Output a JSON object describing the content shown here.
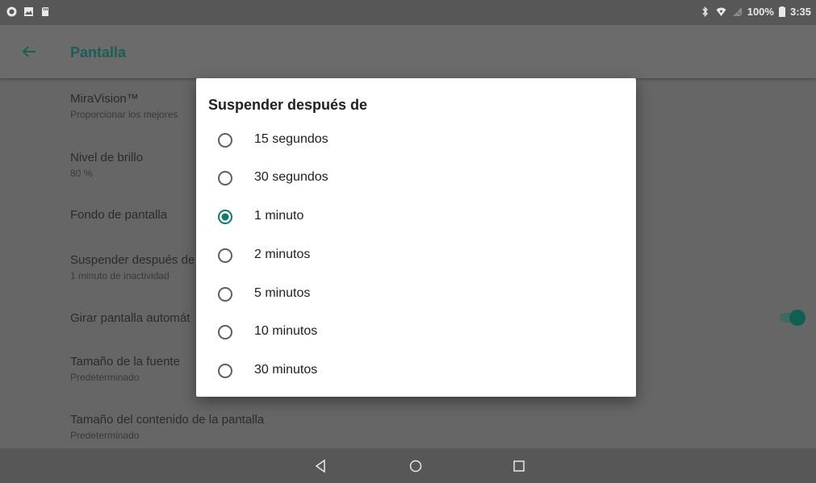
{
  "status_bar": {
    "battery": "100%",
    "time": "3:35",
    "left_icons": [
      "whatsapp-icon",
      "image-icon",
      "sd-card-icon"
    ],
    "right_icons": [
      "bluetooth-icon",
      "wifi-icon",
      "no-sim-icon",
      "battery-icon"
    ]
  },
  "app_bar": {
    "title": "Pantalla",
    "back_icon": "arrow-back-icon"
  },
  "settings": [
    {
      "title": "MiraVision™",
      "summary": "Proporcionar los mejores"
    },
    {
      "title": "Nivel de brillo",
      "summary": "80 %"
    },
    {
      "title": "Fondo de pantalla",
      "summary": ""
    },
    {
      "title": "Suspender después de",
      "summary": "1 minuto de inactividad"
    },
    {
      "title": "Girar pantalla automát",
      "summary": ""
    },
    {
      "title": "Tamaño de la fuente",
      "summary": "Predeterminado"
    },
    {
      "title": "Tamaño del contenido de la pantalla",
      "summary": "Predeterminado"
    }
  ],
  "toggle": {
    "state": "on"
  },
  "dialog": {
    "title": "Suspender después de",
    "options": [
      "15 segundos",
      "30 segundos",
      "1 minuto",
      "2 minutos",
      "5 minutos",
      "10 minutos",
      "30 minutos"
    ],
    "selected": "1 minuto"
  },
  "nav_bar": {
    "icons": [
      "back-triangle-icon",
      "home-circle-icon",
      "recents-square-icon"
    ]
  },
  "colors": {
    "accent": "#0f7a6b",
    "title_teal": "#1c5e56",
    "scrim_bg": "#666666"
  }
}
